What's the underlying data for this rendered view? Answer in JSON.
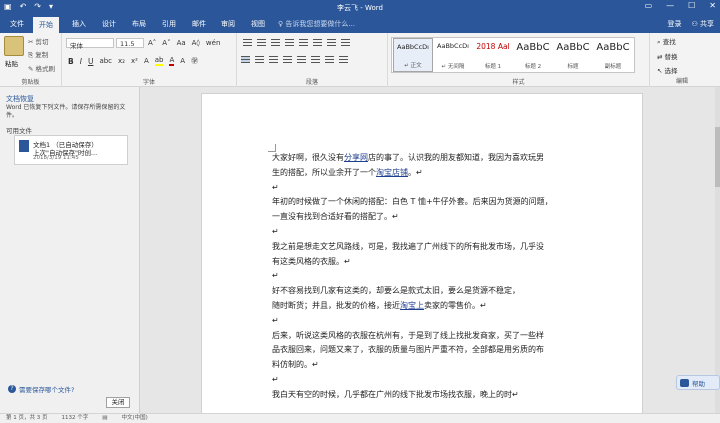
{
  "window": {
    "title": "李云飞 - Word",
    "qat": [
      "save-icon",
      "undo-icon",
      "redo-icon",
      "customize-icon"
    ],
    "controls": [
      "restore-ribbon-icon",
      "minimize-icon",
      "maximize-icon",
      "close-icon"
    ]
  },
  "tabs": [
    "文件",
    "开始",
    "插入",
    "设计",
    "布局",
    "引用",
    "邮件",
    "审阅",
    "视图"
  ],
  "active_tab": "开始",
  "tell_me": "告诉我您想要做什么...",
  "account": {
    "signin": "登录",
    "share": "共享"
  },
  "ribbon": {
    "clipboard": {
      "paste": "粘贴",
      "cut": "剪切",
      "copy": "复制",
      "format_painter": "格式刷",
      "label": "剪贴板"
    },
    "font": {
      "font_name": "宋体",
      "font_size": "11.5",
      "label": "字体"
    },
    "paragraph": {
      "label": "段落"
    },
    "styles": {
      "label": "样式",
      "items": [
        {
          "sample": "AaBbCcDı",
          "name": "↵ 正文",
          "color": "#222222"
        },
        {
          "sample": "AaBbCcDı",
          "name": "↵ 无间隔",
          "color": "#222222"
        },
        {
          "sample": "2018 Aal",
          "name": "标题 1",
          "color": "#c00000"
        },
        {
          "sample": "AaBbC",
          "name": "标题 2",
          "color": "#222222"
        },
        {
          "sample": "AaBbC",
          "name": "标题",
          "color": "#222222"
        },
        {
          "sample": "AaBbC",
          "name": "副标题",
          "color": "#222222"
        }
      ]
    },
    "editing": {
      "find": "查找",
      "replace": "替换",
      "select": "选择",
      "label": "编辑"
    }
  },
  "recovery": {
    "title": "文档恢复",
    "description": "Word 已恢复下列文件。请保存所需保留的文件。",
    "available": "可用文件",
    "file": {
      "name": "文档1 （已自动保存）",
      "info": "上次\"自动保存\"时创...",
      "date": "2018/3/19 11:45"
    },
    "help": "需要保存哪个文件?",
    "close": "关闭"
  },
  "document": {
    "paragraphs": [
      [
        {
          "t": "大家好啊，很久没有"
        },
        {
          "t": "分享网",
          "link": true
        },
        {
          "t": "店的事了。认识我的朋友都知道，我因为喜欢玩男"
        }
      ],
      [
        {
          "t": "生的搭配，所以业余开了一个"
        },
        {
          "t": "淘宝店铺",
          "link": true
        },
        {
          "t": "。↵"
        }
      ],
      [
        {
          "t": "↵"
        }
      ],
      [
        {
          "t": "年初的时候做了一个休闲的搭配：白色 T 恤+牛仔外套。后来因为货源的问题，"
        }
      ],
      [
        {
          "t": "一直没有找到合适好看的搭配了。↵"
        }
      ],
      [
        {
          "t": "  ↵"
        }
      ],
      [
        {
          "t": "我之前是想走文艺风路线，可是，我找遍了广州线下的所有批发市场，几乎没"
        }
      ],
      [
        {
          "t": "有这类风格的衣服。↵"
        }
      ],
      [
        {
          "t": "↵"
        }
      ],
      [
        {
          "t": "好不容易找到几家有这类的，却要么是款式太旧，要么是货源不稳定，"
        }
      ],
      [
        {
          "t": "随时断货；并且，批发的价格，接近"
        },
        {
          "t": "淘宝上",
          "link": true
        },
        {
          "t": "卖家的零售价。↵"
        }
      ],
      [
        {
          "t": "↵"
        }
      ],
      [
        {
          "t": "后来，听说这类风格的衣服在杭州有，于是到了线上找批发商家，买了一些样"
        }
      ],
      [
        {
          "t": "品衣服回来，问题又来了，衣服的质量与图片严重不符，全部都是用劣质的布"
        }
      ],
      [
        {
          "t": "料仿制的。↵"
        }
      ],
      [
        {
          "t": "↵"
        }
      ],
      [
        {
          "t": "我白天有空的时候，几乎都在广州的线下批发市场找衣服，晚上的时↵"
        }
      ]
    ]
  },
  "side_button": "帮助",
  "status": {
    "page": "第 1 页，共 3 页",
    "words": "1132 个字",
    "lang": "中文(中国)"
  }
}
